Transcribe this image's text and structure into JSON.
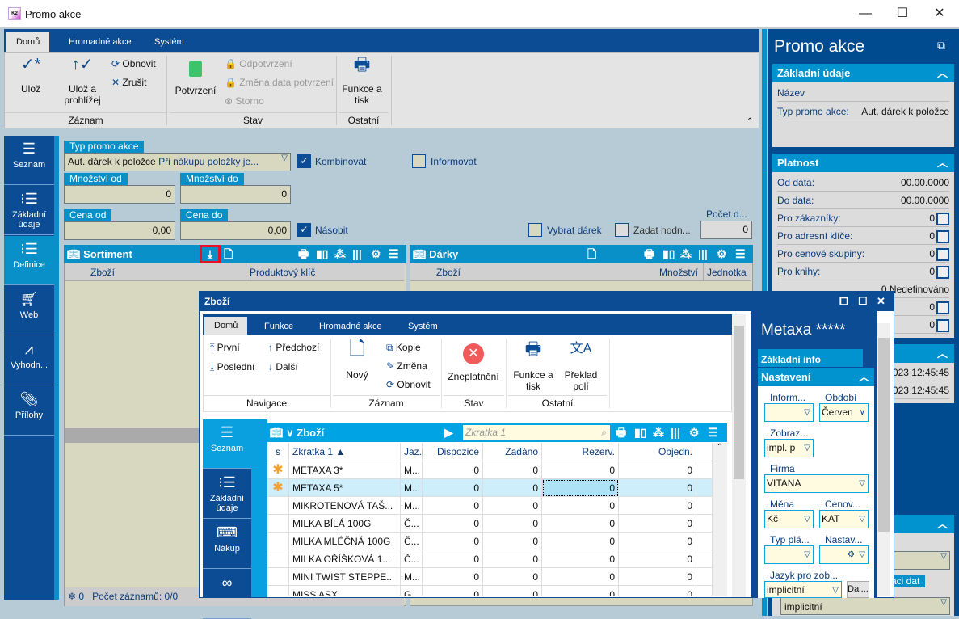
{
  "window": {
    "title": "Promo akce",
    "app_icon": "K2"
  },
  "ribbon": {
    "tabs": [
      "Domů",
      "Hromadné akce",
      "Systém"
    ],
    "save": "Ulož",
    "save_browse": "Ulož a prohlížej",
    "refresh": "Obnovit",
    "cancel": "Zrušit",
    "confirm": "Potvrzení",
    "unconfirm": "Odpotvrzení",
    "change_date": "Změna data potvrzení",
    "storno": "Storno",
    "print": "Funkce a tisk",
    "groups": [
      "Záznam",
      "Stav",
      "Ostatní"
    ]
  },
  "leftnav": {
    "items": [
      {
        "label": "Seznam",
        "icon": "list-icon"
      },
      {
        "label": "Základní údaje",
        "icon": "bullet-list-icon"
      },
      {
        "label": "Definice",
        "icon": "bullet-list-icon",
        "active": true
      },
      {
        "label": "Web",
        "icon": "cart-icon"
      },
      {
        "label": "Vyhodn...",
        "icon": "chart-icon"
      },
      {
        "label": "Přílohy",
        "icon": "paperclip-icon"
      }
    ]
  },
  "form": {
    "typ_label": "Typ promo akce",
    "typ_value": "Aut. dárek k položce",
    "typ_desc": "Při nákupu položky je...",
    "kombinovat": "Kombinovat",
    "kombinovat_checked": true,
    "informovat": "Informovat",
    "informovat_checked": false,
    "mnozstvi_od_label": "Množství od",
    "mnozstvi_od": "0",
    "mnozstvi_do_label": "Množství do",
    "mnozstvi_do": "0",
    "cena_od_label": "Cena od",
    "cena_od": "0,00",
    "cena_do_label": "Cena do",
    "cena_do": "0,00",
    "nasobit": "Násobit",
    "nasobit_checked": true,
    "vybrat_darek": "Vybrat dárek",
    "zadat_hodn": "Zadat hodn...",
    "pocet_label": "Počet d...",
    "pocet": "0"
  },
  "sortiment": {
    "title": "Sortiment",
    "columns": [
      "Zboží",
      "Produktový klíč"
    ],
    "footer_count": "0",
    "footer_text": "Počet záznamů: 0/0"
  },
  "darky": {
    "title": "Dárky",
    "columns": [
      "Zboží",
      "Množství",
      "Jednotka"
    ]
  },
  "right_panel": {
    "title": "Promo akce",
    "zakladni": {
      "title": "Základní údaje",
      "nazev_label": "Název",
      "typ_label": "Typ promo akce:",
      "typ_value": "Aut. dárek k položce"
    },
    "platnost": {
      "title": "Platnost",
      "rows": [
        {
          "label": "Od data:",
          "value": "00.00.0000"
        },
        {
          "label": "Do data:",
          "value": "00.00.0000"
        },
        {
          "label": "Pro zákazníky:",
          "value": "0"
        },
        {
          "label": "Pro adresní klíče:",
          "value": "0"
        },
        {
          "label": "Pro cenové skupiny:",
          "value": "0"
        },
        {
          "label": "Pro knihy:",
          "value": "0"
        }
      ],
      "partial": "0 Nedefinováno",
      "r7": "0",
      "r8": "0"
    },
    "dates": [
      "2023 12:45:45",
      "2023 12:45:45"
    ],
    "tail_label": "aci dat",
    "tail_value": "implicitní"
  },
  "popup": {
    "title": "Zboží",
    "tabs": [
      "Domů",
      "Funkce",
      "Hromadné akce",
      "Systém"
    ],
    "nav": {
      "first": "První",
      "prev": "Předchozí",
      "last": "Poslední",
      "next": "Další",
      "group": "Navigace"
    },
    "zaznam": {
      "new": "Nový",
      "copy": "Kopie",
      "change": "Změna",
      "refresh": "Obnovit",
      "group": "Záznam"
    },
    "stav": {
      "invalidate": "Zneplatnění",
      "group": "Stav"
    },
    "ostatni": {
      "print": "Funkce a tisk",
      "translate": "Překlad polí",
      "group": "Ostatní"
    },
    "leftnav": [
      "Seznam",
      "Základní údaje",
      "Nákup",
      ""
    ],
    "grid": {
      "title": "Zboží",
      "search_placeholder": "Zkratka 1",
      "columns": [
        "s",
        "Zkratka 1 ▲",
        "Jaz.r",
        "Dispozice",
        "Zadáno",
        "Rezerv.",
        "Objedn."
      ],
      "rows": [
        {
          "star": true,
          "name": "METAXA 3*",
          "jaz": "M...",
          "disp": "0",
          "zad": "0",
          "rez": "0",
          "obj": "0"
        },
        {
          "star": true,
          "name": "METAXA 5*",
          "jaz": "M...",
          "disp": "0",
          "zad": "0",
          "rez": "0",
          "obj": "0",
          "selected": true
        },
        {
          "star": false,
          "name": "MIKROTENOVÁ TAŠ...",
          "jaz": "M...",
          "disp": "0",
          "zad": "0",
          "rez": "0",
          "obj": "0"
        },
        {
          "star": false,
          "name": "MILKA BÍLÁ 100G",
          "jaz": "Č...",
          "disp": "0",
          "zad": "0",
          "rez": "0",
          "obj": "0"
        },
        {
          "star": false,
          "name": "MILKA MLÉČNÁ 100G",
          "jaz": "Č...",
          "disp": "0",
          "zad": "0",
          "rez": "0",
          "obj": "0"
        },
        {
          "star": false,
          "name": "MILKA OŘÍŠKOVÁ 1...",
          "jaz": "Č...",
          "disp": "0",
          "zad": "0",
          "rez": "0",
          "obj": "0"
        },
        {
          "star": false,
          "name": "MINI TWIST STEPPE...",
          "jaz": "M...",
          "disp": "0",
          "zad": "0",
          "rez": "0",
          "obj": "0"
        },
        {
          "star": false,
          "name": "MISS ASX",
          "jaz": "G...",
          "disp": "0",
          "zad": "0",
          "rez": "0",
          "obj": "0"
        }
      ]
    },
    "detail": {
      "title": "Metaxa *****",
      "zakladni": "Základní info",
      "nastaveni": "Nastavení",
      "inform_label": "Inform...",
      "inform": "",
      "obdobi_label": "Období",
      "obdobi": "Červen",
      "zobraz_label": "Zobraz...",
      "zobraz": "impl. p",
      "firma_label": "Firma",
      "firma": "VITANA",
      "mena_label": "Měna",
      "mena": "Kč",
      "cenov_label": "Cenov...",
      "cenov": "KAT",
      "typpla_label": "Typ plá...",
      "typpla": "",
      "nastav_label": "Nastav...",
      "jazyk_label": "Jazyk pro zob...",
      "jazyk": "implicitní",
      "dal": "Dal..."
    }
  },
  "colors": {
    "dark_blue": "#0b4c94",
    "accent_blue": "#0a90c8",
    "input_beige": "#d8d8c0",
    "highlight": "#e81123"
  }
}
